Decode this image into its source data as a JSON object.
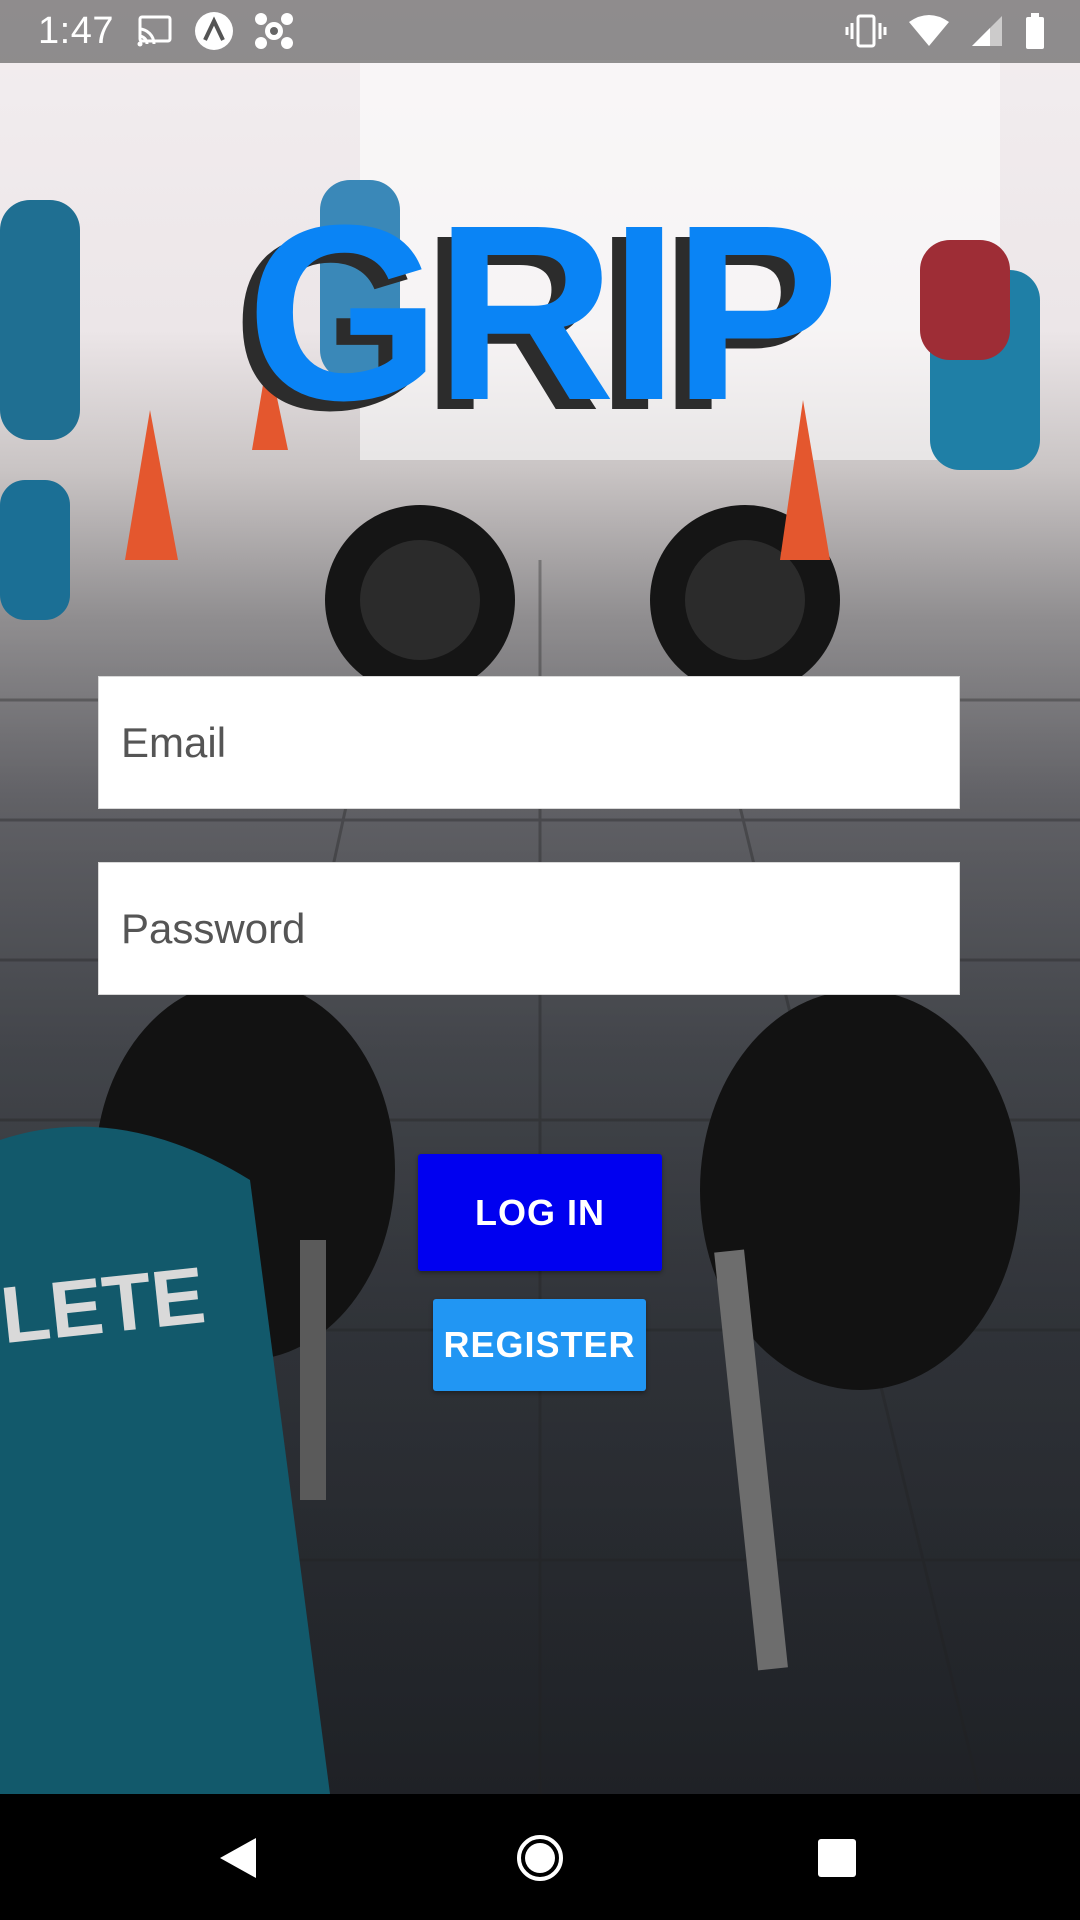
{
  "status_bar": {
    "time": "1:47",
    "left_icons": [
      "cast-icon",
      "app-a-icon",
      "app-settings-icon"
    ],
    "right_icons": [
      "vibrate-icon",
      "wifi-icon",
      "signal-icon",
      "battery-icon"
    ]
  },
  "logo": {
    "text": "GRIP"
  },
  "login_form": {
    "email_placeholder": "Email",
    "password_placeholder": "Password",
    "login_label": "LOG IN",
    "register_label": "REGISTER"
  },
  "nav_bar": {
    "icons": [
      "back-icon",
      "home-icon",
      "recents-icon"
    ]
  },
  "colors": {
    "logo": "#0a84f5",
    "logo_shadow": "#2c2c2c",
    "login_button": "#0000f0",
    "register_button": "#2196f3"
  }
}
